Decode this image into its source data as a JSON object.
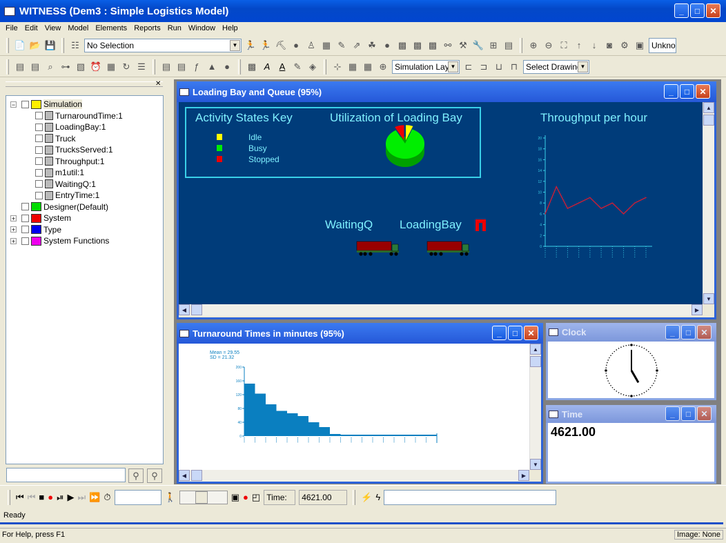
{
  "app": {
    "title": "WITNESS (Dem3 : Simple Logistics Model)"
  },
  "menu": [
    "File",
    "Edit",
    "View",
    "Model",
    "Elements",
    "Reports",
    "Run",
    "Window",
    "Help"
  ],
  "toolbar": {
    "selection_combo": "No Selection",
    "unknown_field": "Unkno",
    "layer_combo": "Simulation Lay",
    "drawing_combo": "Select Drawing"
  },
  "tree": {
    "items": [
      {
        "label": "Simulation",
        "icon": "folder-yellow-icon",
        "color": "#ffee00"
      },
      {
        "label": "TurnaroundTime:1",
        "icon": "histogram-icon"
      },
      {
        "label": "LoadingBay:1",
        "icon": "machine-icon"
      },
      {
        "label": "Truck",
        "icon": "part-icon"
      },
      {
        "label": "TrucksServed:1",
        "icon": "counter-icon"
      },
      {
        "label": "Throughput:1",
        "icon": "timeseries-icon"
      },
      {
        "label": "m1util:1",
        "icon": "piechart-icon"
      },
      {
        "label": "WaitingQ:1",
        "icon": "buffer-icon"
      },
      {
        "label": "EntryTime:1",
        "icon": "attribute-icon"
      },
      {
        "label": "Designer(Default)",
        "icon": "folder-green-icon",
        "color": "#00dd00"
      },
      {
        "label": "System",
        "icon": "folder-red-icon",
        "color": "#ee0000"
      },
      {
        "label": "Type",
        "icon": "folder-blue-icon",
        "color": "#0000ee"
      },
      {
        "label": "System Functions",
        "icon": "folder-magenta-icon",
        "color": "#ee00ee"
      }
    ]
  },
  "windows": {
    "loading": {
      "title": "Loading Bay and Queue (95%)",
      "key_title": "Activity States Key",
      "states": [
        {
          "label": "Idle",
          "color": "#ffff00"
        },
        {
          "label": "Busy",
          "color": "#00ee00"
        },
        {
          "label": "Stopped",
          "color": "#ee0000"
        }
      ],
      "pie_title": "Utilization of Loading Bay",
      "throughput_title": "Throughput per hour",
      "waitingq_label": "WaitingQ",
      "loadingbay_label": "LoadingBay"
    },
    "turnaround": {
      "title": "Turnaround Times in minutes (95%)",
      "mean": "Mean = 29.55",
      "sd": "SD = 21.32"
    },
    "clock": {
      "title": "Clock",
      "hour": 5,
      "minute": 0
    },
    "time": {
      "title": "Time",
      "value": "4621.00"
    }
  },
  "chart_data": [
    {
      "type": "pie",
      "title": "Utilization of Loading Bay",
      "categories": [
        "Idle",
        "Busy",
        "Stopped"
      ],
      "values": [
        6,
        86,
        8
      ],
      "colors": [
        "#ffff00",
        "#00ee00",
        "#ee0000"
      ]
    },
    {
      "type": "line",
      "title": "Throughput per hour",
      "y": [
        6,
        11,
        7,
        8,
        9,
        7,
        8,
        6,
        8,
        9
      ],
      "ylim": [
        0,
        20
      ],
      "yticks": [
        0,
        2,
        4,
        6,
        8,
        10,
        12,
        14,
        16,
        18,
        20
      ],
      "color": "#c0203a"
    },
    {
      "type": "bar",
      "title": "Turnaround Times in minutes",
      "values": [
        152,
        123,
        92,
        73,
        66,
        58,
        40,
        26,
        6,
        0,
        0,
        0,
        0,
        0,
        0,
        0,
        0,
        0
      ],
      "ylim": [
        0,
        200
      ],
      "yticks": [
        0,
        40,
        80,
        120,
        160,
        200
      ],
      "color": "#0a7fc0"
    }
  ],
  "runbar": {
    "time_label": "Time:",
    "time_value": "4621.00"
  },
  "status": {
    "ready": "Ready",
    "help": "For Help, press F1",
    "image": "Image: None"
  }
}
